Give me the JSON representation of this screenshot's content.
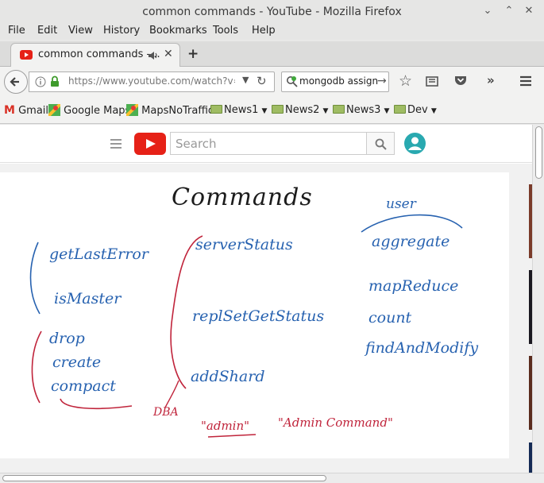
{
  "window": {
    "title": "common commands - YouTube - Mozilla Firefox"
  },
  "menu": {
    "file": "File",
    "edit": "Edit",
    "view": "View",
    "history": "History",
    "bookmarks": "Bookmarks",
    "tools": "Tools",
    "help": "Help"
  },
  "tab": {
    "title": "common commands -...",
    "icon": "youtube-favicon"
  },
  "nav": {
    "url": "https://www.youtube.com/watch?v=E",
    "search_value": "mongodb assign"
  },
  "bookmarks": [
    {
      "label": "Gmail",
      "icon": "gmail-icon"
    },
    {
      "label": "Google Maps",
      "icon": "maps-icon"
    },
    {
      "label": "MapsNoTraffic",
      "icon": "maps-icon"
    },
    {
      "label": "News1"
    },
    {
      "label": "News2"
    },
    {
      "label": "News3"
    },
    {
      "label": "Dev"
    }
  ],
  "youtube": {
    "search_placeholder": "Search"
  },
  "whiteboard": {
    "title": "Commands",
    "left_group": [
      "getLastError",
      "isMaster"
    ],
    "admin_group": [
      "drop",
      "create",
      "compact"
    ],
    "middle_group": [
      "serverStatus",
      "replSetGetStatus",
      "addShard"
    ],
    "dba_label": "DBA",
    "user_label": "user",
    "user_group": [
      "aggregate",
      "mapReduce",
      "count",
      "findAndModify"
    ],
    "admin_label": "\"admin\"",
    "admin_command_label": "\"Admin Command\""
  },
  "colors": {
    "ink_blue": "#2762b0",
    "ink_red": "#c0243b",
    "ink_black": "#1c1c1c",
    "youtube_red": "#e62117"
  }
}
